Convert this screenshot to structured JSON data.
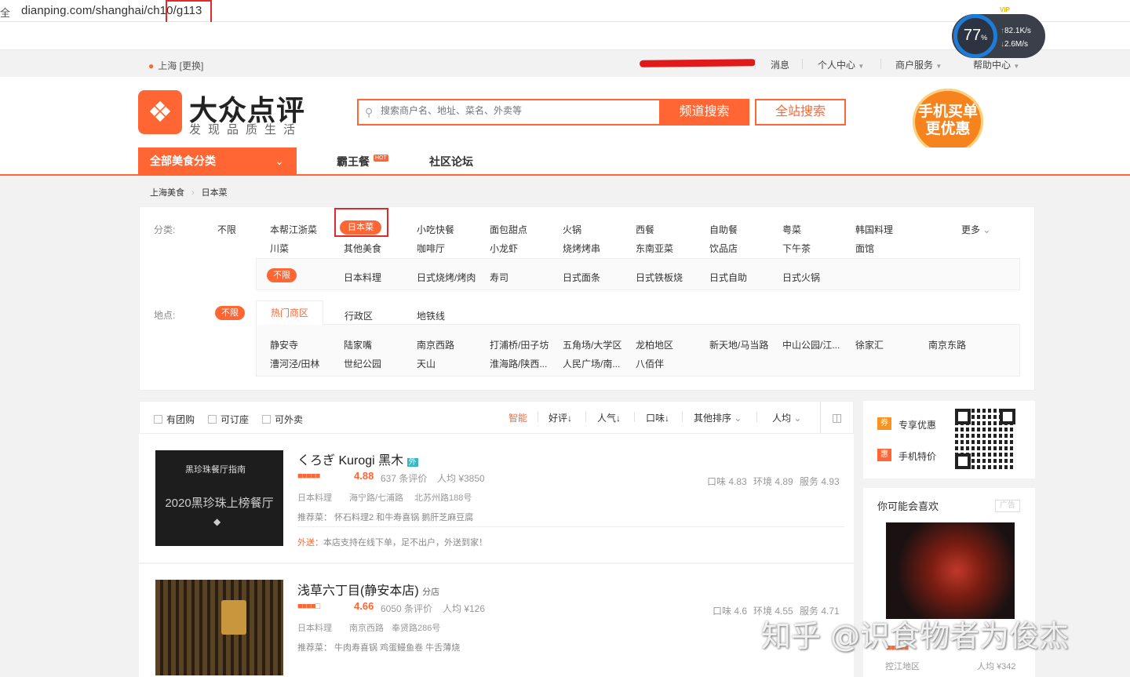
{
  "browser": {
    "url_prefix": "dianping.com/shanghai/ch10",
    "url_highlight": "/g113",
    "lock": "全"
  },
  "speed_widget": {
    "percent": "77",
    "percent_unit": "%",
    "upload": "82.1K/s",
    "download": "2.6M/s",
    "vip": "VIP"
  },
  "topbar": {
    "city": "上海",
    "change": "[更换]",
    "messages": "消息",
    "personal": "个人中心",
    "merchant": "商户服务",
    "help": "帮助中心"
  },
  "header": {
    "logo_title": "大众点评",
    "logo_sub": "发现品质生活",
    "search_placeholder": "搜索商户名、地址、菜名、外卖等",
    "channel_search": "频道搜索",
    "site_search": "全站搜索",
    "app_promo_line1": "手机买单",
    "app_promo_line2": "更优惠"
  },
  "nav": {
    "all_categories": "全部美食分类",
    "bawangcan": "霸王餐",
    "hot": "HOT",
    "forum": "社区论坛"
  },
  "breadcrumb": [
    "上海美食",
    "日本菜"
  ],
  "filters": {
    "category_label": "分类:",
    "location_label": "地点:",
    "unlimited": "不限",
    "more": "更多",
    "categories_row1": [
      "本帮江浙菜",
      "日本菜",
      "小吃快餐",
      "面包甜点",
      "火锅",
      "西餐",
      "自助餐",
      "粤菜",
      "韩国料理"
    ],
    "categories_row2": [
      "川菜",
      "其他美食",
      "咖啡厅",
      "小龙虾",
      "烧烤烤串",
      "东南亚菜",
      "饮品店",
      "下午茶",
      "面馆"
    ],
    "sub_categories": [
      "不限",
      "日本料理",
      "日式烧烤/烤肉",
      "寿司",
      "日式面条",
      "日式铁板烧",
      "日式自助",
      "日式火锅"
    ],
    "location_tabs": [
      "热门商区",
      "行政区",
      "地铁线"
    ],
    "areas_row1": [
      "静安寺",
      "陆家嘴",
      "南京西路",
      "打浦桥/田子坊",
      "五角场/大学区",
      "龙柏地区",
      "新天地/马当路",
      "中山公园/江...",
      "徐家汇",
      "南京东路"
    ],
    "areas_row2": [
      "漕河泾/田林",
      "世纪公园",
      "天山",
      "淮海路/陕西...",
      "人民广场/南...",
      "八佰伴"
    ]
  },
  "sortbar": {
    "checkboxes": [
      "有团购",
      "可订座",
      "可外卖"
    ],
    "sorts": [
      "智能",
      "好评",
      "人气",
      "口味",
      "其他排序",
      "人均"
    ]
  },
  "listings": [
    {
      "name": "くろぎ Kurogi 黑木",
      "badge": "外",
      "rating": "4.88",
      "reviews": "637 条评价",
      "avg": "人均 ¥3850",
      "cuisine": "日本料理",
      "area": "海宁路/七浦路",
      "address": "北苏州路188号",
      "recommend": "推荐菜：   怀石料理2  和牛寿喜锅  鹅肝芝麻豆腐",
      "delivery_label": "外送：",
      "delivery_text": "本店支持在线下单，足不出户，外送到家！",
      "taste": "口味 4.83",
      "env": "环境 4.89",
      "service": "服务 4.93",
      "thumb_title": "黑珍珠餐厅指南",
      "thumb_line": "2020黑珍珠上榜餐厅"
    },
    {
      "name": "浅草六丁目(静安本店)",
      "badge": "分店",
      "rating": "4.66",
      "reviews": "6050 条评价",
      "avg": "人均 ¥126",
      "cuisine": "日本料理",
      "area": "南京西路",
      "address": "奉贤路286号",
      "recommend": "推荐菜：   牛肉寿喜锅  鸡蛋鳗鱼卷  牛舌薄烧",
      "taste": "口味 4.6",
      "env": "环境 4.55",
      "service": "服务 4.71"
    }
  ],
  "sidebar": {
    "coupon": "专享优惠",
    "coupon_icon": "券",
    "mobile": "手机特价",
    "mobile_icon": "惠",
    "like_title": "你可能会喜欢",
    "ad": "广告",
    "like_area": "控江地区",
    "like_avg": "人均 ¥342"
  },
  "watermark": "知乎 @识食物者为俊杰",
  "colors": {
    "brand": "#ff6633",
    "highlight": "#e12a2a"
  }
}
